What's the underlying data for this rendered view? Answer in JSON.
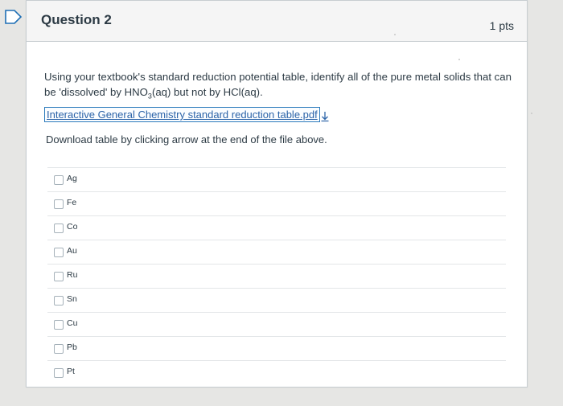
{
  "question": {
    "title": "Question 2",
    "points": "1 pts",
    "prompt": "Using your textbook's standard reduction potential table, identify all of the pure metal solids that can be 'dissolved' by HNO3(aq) but not by HCl(aq).",
    "prompt_parts": {
      "before": "Using your textbook's standard reduction potential table, identify all of the pure metal solids that can be 'dissolved' by HNO",
      "sub": "3",
      "after": "(aq) but not by HCl(aq)."
    },
    "file_link": "Interactive General Chemistry standard reduction table.pdf",
    "download_note": "Download table by clicking arrow at the end of the file above.",
    "answers": [
      {
        "label": "Ag",
        "checked": false
      },
      {
        "label": "Fe",
        "checked": false
      },
      {
        "label": "Co",
        "checked": false
      },
      {
        "label": "Au",
        "checked": false
      },
      {
        "label": "Ru",
        "checked": false
      },
      {
        "label": "Sn",
        "checked": false
      },
      {
        "label": "Cu",
        "checked": false
      },
      {
        "label": "Pb",
        "checked": false
      },
      {
        "label": "Pt",
        "checked": false
      }
    ]
  },
  "colors": {
    "link": "#2b63a8",
    "text": "#2d3b45",
    "flag": "#1e6fb5"
  },
  "icons": {
    "flag": "bookmark-flag-icon",
    "download": "download-arrow-icon",
    "checkbox": "checkbox-icon"
  }
}
